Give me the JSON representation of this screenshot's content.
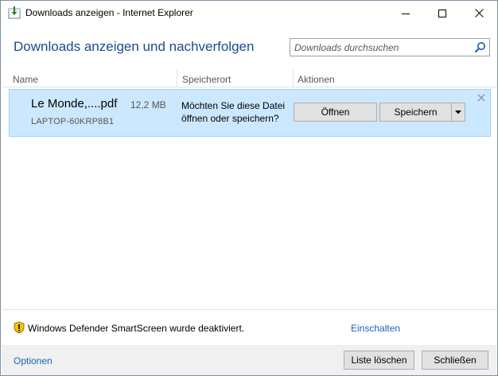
{
  "window": {
    "title": "Downloads anzeigen - Internet Explorer"
  },
  "header": {
    "title": "Downloads anzeigen und nachverfolgen"
  },
  "search": {
    "placeholder": "Downloads durchsuchen",
    "value": ""
  },
  "columns": {
    "name": "Name",
    "location": "Speicherort",
    "actions": "Aktionen"
  },
  "download": {
    "file_name": "Le Monde,....pdf",
    "file_size": "12,2 MB",
    "source": "LAPTOP-60KRP8B1",
    "question": "Möchten Sie diese Datei öffnen oder speichern?",
    "open_label": "Öffnen",
    "save_label": "Speichern"
  },
  "smartscreen": {
    "message": "Windows Defender SmartScreen wurde deaktiviert.",
    "enable_link": "Einschalten"
  },
  "footer": {
    "options_link": "Optionen",
    "clear_list_label": "Liste löschen",
    "close_label": "Schließen"
  },
  "icons": {
    "app": "ie-downloads-icon",
    "search": "search-icon",
    "shield": "warning-shield-icon",
    "dropdown": "chevron-down-icon",
    "remove": "close-icon"
  },
  "colors": {
    "title_blue": "#1c4a8c",
    "link_blue": "#1a62b8",
    "selected_row": "#cce8ff",
    "selected_border": "#99d1ff",
    "footer_bg": "#f0f0f0"
  }
}
